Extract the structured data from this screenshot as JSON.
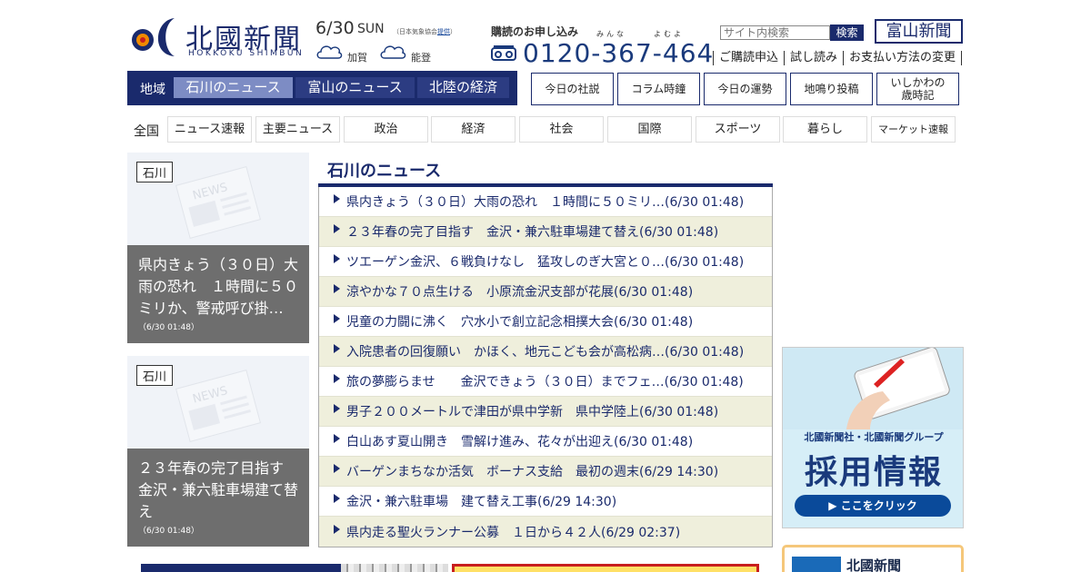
{
  "header": {
    "logo_text": "北國新聞",
    "logo_roman": "HOKKOKU SHIMBUN",
    "date": "6/30",
    "day": "SUN",
    "weather_source_prefix": "（日本気象協会",
    "weather_source_link": "提供",
    "weather_source_suffix": "）",
    "weather": [
      {
        "icon": "cloud-icon",
        "area": "加賀"
      },
      {
        "icon": "cloud-icon",
        "area": "能登"
      }
    ],
    "subscribe_label": "購読のお申し込み",
    "phone_ruby_1": "みんな",
    "phone_ruby_2": "よむよ",
    "phone_number": "0120-367-464",
    "search_placeholder": "サイト内検索",
    "search_button": "検索",
    "toyama_paper": "富山新聞",
    "sub_links": [
      "ご購読申込",
      "試し読み",
      "お支払い方法の変更"
    ]
  },
  "region_nav": {
    "label": "地域",
    "tabs": [
      {
        "label": "石川のニュース",
        "active": true
      },
      {
        "label": "富山のニュース",
        "active": false
      },
      {
        "label": "北陸の経済",
        "active": false
      }
    ]
  },
  "side_buttons": [
    "今日の社説",
    "コラム時鐘",
    "今日の運勢",
    "地鳴り投稿",
    "いしかわの",
    "歳時記"
  ],
  "category_nav": {
    "all_label": "全国",
    "items": [
      "ニュース速報",
      "主要ニュース",
      "政治",
      "経済",
      "社会",
      "国際",
      "スポーツ",
      "暮らし",
      "マーケット速報"
    ]
  },
  "features": [
    {
      "tag": "石川",
      "title": "県内きょう（３０日）大雨の恐れ　１時間に５０ミリか、警戒呼び掛…",
      "time": "（6/30 01:48）"
    },
    {
      "tag": "石川",
      "title": "２３年春の完了目指す　金沢・兼六駐車場建て替え",
      "time": "（6/30 01:48）"
    }
  ],
  "news": {
    "heading": "石川のニュース",
    "items": [
      "県内きょう（３０日）大雨の恐れ　１時間に５０ミリ…(6/30 01:48)",
      "２３年春の完了目指す　金沢・兼六駐車場建て替え(6/30 01:48)",
      "ツエーゲン金沢、６戦負けなし　猛攻しのぎ大宮と０…(6/30 01:48)",
      "涼やかな７０点生ける　小原流金沢支部が花展(6/30 01:48)",
      "児童の力闘に沸く　穴水小で創立記念相撲大会(6/30 01:48)",
      "入院患者の回復願い　かほく、地元こども会が高松病…(6/30 01:48)",
      "旅の夢膨らませ　　金沢できょう（３０日）までフェ…(6/30 01:48)",
      "男子２００メートルで津田が県中学新　県中学陸上(6/30 01:48)",
      "白山あす夏山開き　雪解け進み、花々が出迎え(6/30 01:48)",
      "バーゲンまちなか活気　ボーナス支給　最初の週末(6/29 14:30)",
      "金沢・兼六駐車場　建て替え工事(6/29 14:30)",
      "県内走る聖火ランナー公募　１日から４２人(6/29 02:37)"
    ]
  },
  "ads": {
    "recruit_line1": "北國新聞社・北國新聞グループ",
    "recruit_line2": "採用情報",
    "recruit_button": "▶ ここをクリック",
    "card_text": "北國新聞"
  },
  "colors": {
    "brand_navy": "#1a2a6c",
    "active_tab": "#7d8cc4",
    "row_alt": "#efefdc"
  }
}
